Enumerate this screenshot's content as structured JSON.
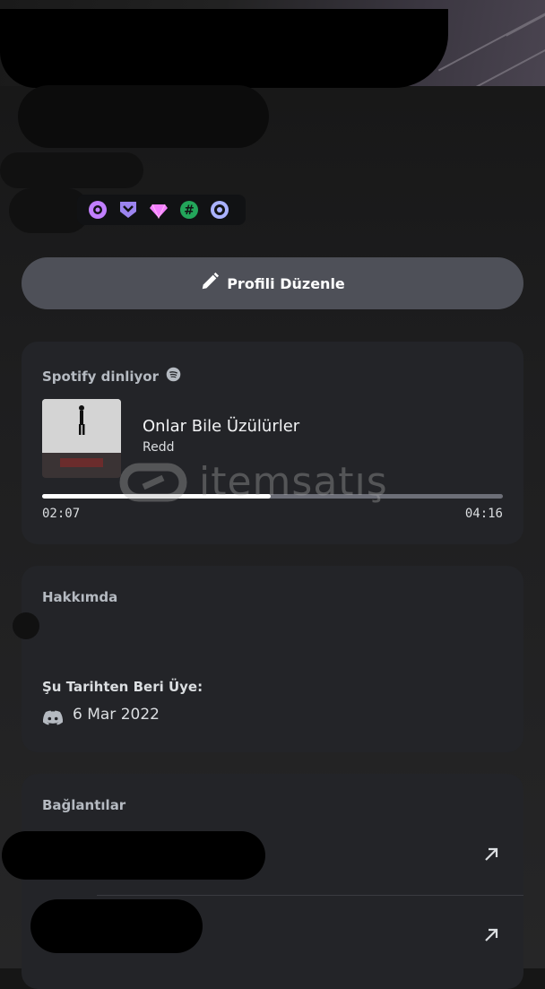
{
  "badges": [
    "nitro-orbit-icon",
    "hypesquad-icon",
    "nitro-gem-icon",
    "hashtag-badge-icon",
    "quest-badge-icon"
  ],
  "edit_profile": {
    "label": "Profili Düzenle",
    "icon": "pencil-icon"
  },
  "spotify": {
    "title": "Spotify dinliyor",
    "song": "Onlar Bile Üzülürler",
    "artist": "Redd",
    "current_time": "02:07",
    "total_time": "04:16",
    "progress": 0.497
  },
  "about": {
    "title": "Hakkımda",
    "member_since_label": "Şu Tarihten Beri Üye:",
    "member_since_date": "6 Mar 2022"
  },
  "connections": {
    "title": "Bağlantılar"
  },
  "watermark": {
    "text": "itemsatış"
  },
  "colors": {
    "button": "#4e5058",
    "card": "#232428",
    "accent": "#ffffff"
  }
}
